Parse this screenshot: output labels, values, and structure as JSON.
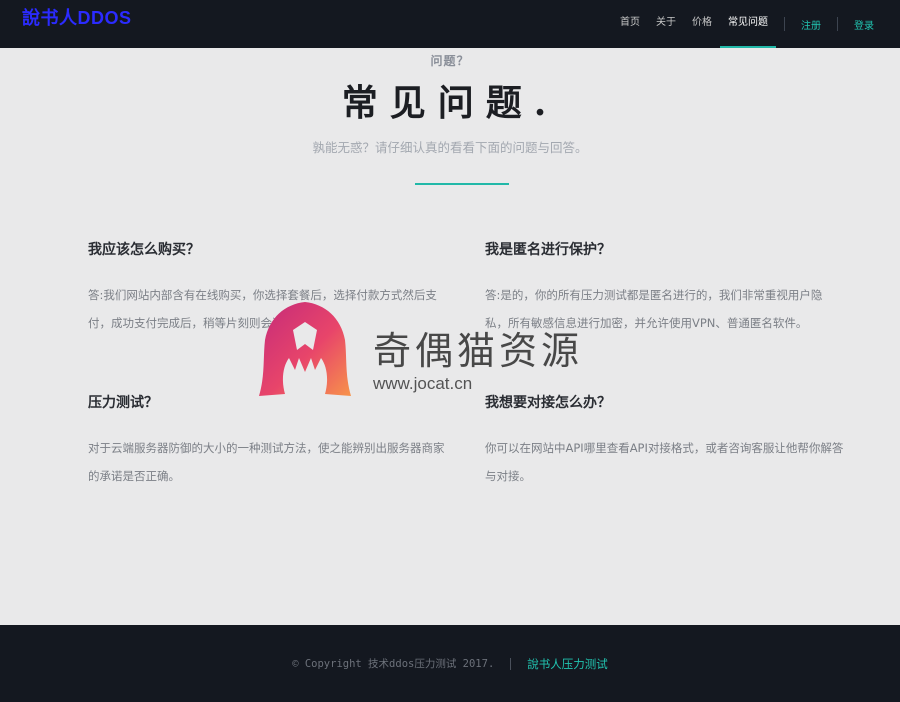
{
  "header": {
    "logo": "說书人DDOS",
    "nav": [
      {
        "label": "首页"
      },
      {
        "label": "关于"
      },
      {
        "label": "价格"
      },
      {
        "label": "常见问题",
        "active": true
      }
    ],
    "register": "注册",
    "login": "登录"
  },
  "hero": {
    "kicker": "问题？",
    "title": "常见问题.",
    "subtitle": "孰能无惑？请仔细认真的看看下面的问题与回答。"
  },
  "faq": [
    {
      "q": "我应该怎么购买？",
      "a": "答:我们网站内部含有在线购买，你选择套餐后，选择付款方式然后支付，成功支付完成后，稍等片刻则会进行通成功。"
    },
    {
      "q": "我是匿名进行保护？",
      "a": "答:是的，你的所有压力测试都是匿名进行的，我们非常重视用户隐私，所有敏感信息进行加密，并允许使用VPN、普通匿名软件。"
    },
    {
      "q": "压力测试？",
      "a": "对于云端服务器防御的大小的一种测试方法，使之能辨别出服务器商家的承诺是否正确。"
    },
    {
      "q": "我想要对接怎么办？",
      "a": "你可以在网站中API哪里查看API对接格式，或者咨询客服让他帮你解答与对接。"
    }
  ],
  "watermark": {
    "title": "奇偶猫资源",
    "url": "www.jocat.cn"
  },
  "footer": {
    "copyright": "© Copyright 技术ddos压力测试 2017.",
    "link": "說书人压力测试"
  },
  "colors": {
    "accent": "#21b8a8",
    "header_bg": "#141820",
    "page_bg": "#e9e9ea",
    "logo": "#2b2bff"
  }
}
